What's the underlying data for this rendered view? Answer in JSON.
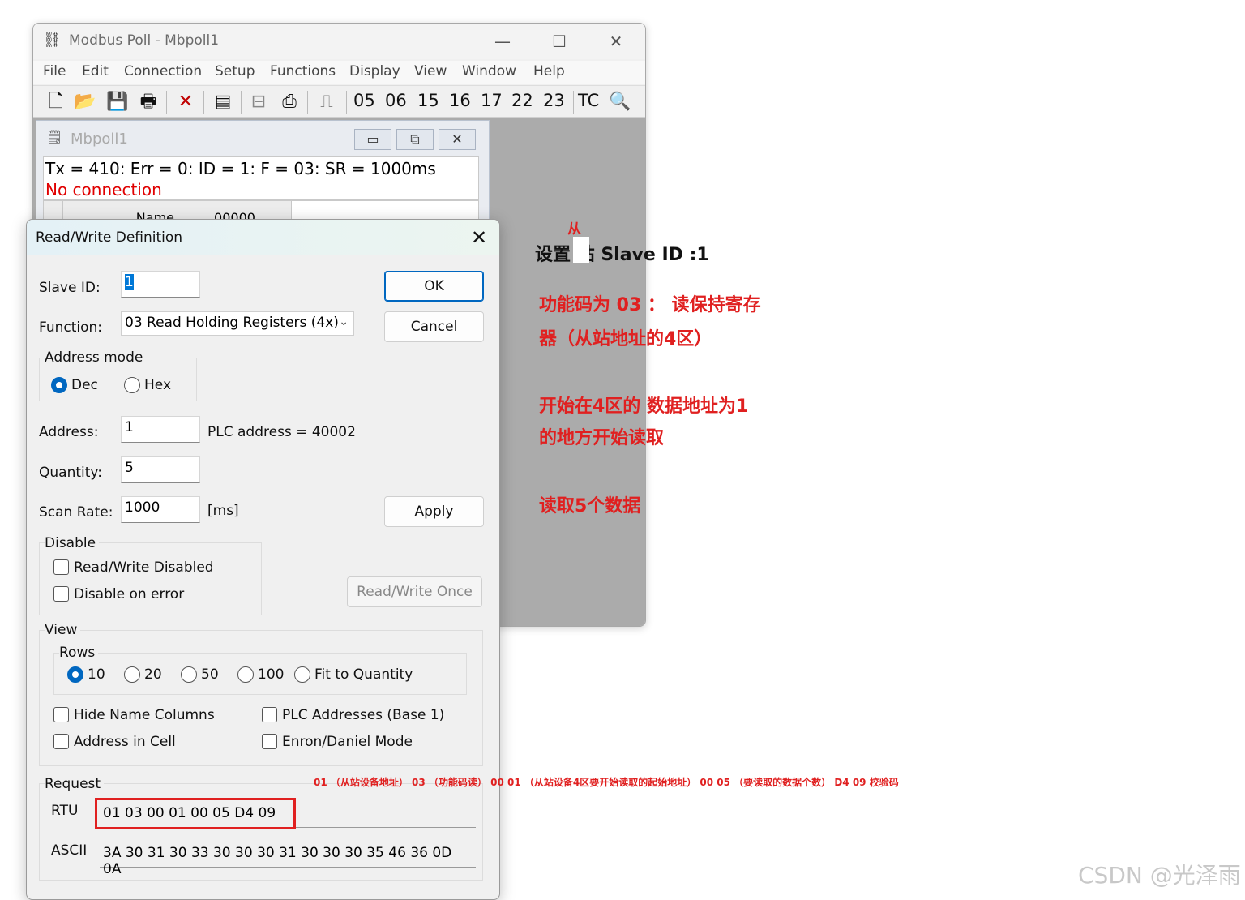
{
  "main_window": {
    "title": "Modbus Poll - Mbpoll1",
    "controls": {
      "minimize": "—",
      "maximize": "☐",
      "close": "✕"
    },
    "menu": [
      "File",
      "Edit",
      "Connection",
      "Setup",
      "Functions",
      "Display",
      "View",
      "Window",
      "Help"
    ],
    "toolbar_function_codes": [
      "05",
      "06",
      "15",
      "16",
      "17",
      "22",
      "23"
    ],
    "toolbar_tc": "TC"
  },
  "child_window": {
    "title": "Mbpoll1",
    "status_line": "Tx = 410: Err = 0: ID = 1: F = 03: SR = 1000ms",
    "connection_status": "No connection",
    "grid_header": {
      "name": "Name",
      "col0": "00000"
    }
  },
  "dialog": {
    "title": "Read/Write Definition",
    "close": "✕",
    "slave_id": {
      "label": "Slave ID:",
      "value": "1"
    },
    "function": {
      "label": "Function:",
      "value": "03 Read Holding Registers (4x)"
    },
    "address_mode": {
      "title": "Address mode",
      "dec": "Dec",
      "hex": "Hex",
      "selected": "Dec"
    },
    "address": {
      "label": "Address:",
      "value": "1",
      "plc_address": "PLC address = 40002"
    },
    "quantity": {
      "label": "Quantity:",
      "value": "5"
    },
    "scan_rate": {
      "label": "Scan Rate:",
      "value": "1000",
      "unit": "[ms]"
    },
    "buttons": {
      "ok": "OK",
      "cancel": "Cancel",
      "apply": "Apply",
      "rw_once": "Read/Write Once"
    },
    "disable": {
      "title": "Disable",
      "rw_disabled": "Read/Write Disabled",
      "on_error": "Disable on error"
    },
    "view": {
      "title": "View",
      "rows_title": "Rows",
      "rows_options": [
        "10",
        "20",
        "50",
        "100",
        "Fit to Quantity"
      ],
      "rows_selected": "10",
      "hide_name_columns": "Hide Name Columns",
      "plc_addresses": "PLC Addresses (Base 1)",
      "address_in_cell": "Address in Cell",
      "enron_daniel": "Enron/Daniel Mode"
    },
    "request": {
      "title": "Request",
      "rtu_label": "RTU",
      "rtu_value": "01 03 00 01 00 05 D4 09",
      "ascii_label": "ASCII",
      "ascii_value": "3A 30 31 30 33 30 30 30 31 30 30 30 35 46 36 0D 0A"
    }
  },
  "annotations": {
    "cong": "从",
    "slave_id_note": "设置 站 Slave ID :1",
    "function_note_1": "功能码为 03 ： 读保持寄存",
    "function_note_2": "器（从站地址的4区）",
    "address_note_1": "开始在4区的 数据地址为1",
    "address_note_2": "的地方开始读取",
    "quantity_note": "读取5个数据",
    "request_breakdown": "01 （从站设备地址） 03 （功能码读） 00 01 （从站设备4区要开始读取的起始地址） 00 05 （要读取的数据个数） D4 09 校验码",
    "watermark": "CSDN @光泽雨",
    "color": "#e02020"
  }
}
